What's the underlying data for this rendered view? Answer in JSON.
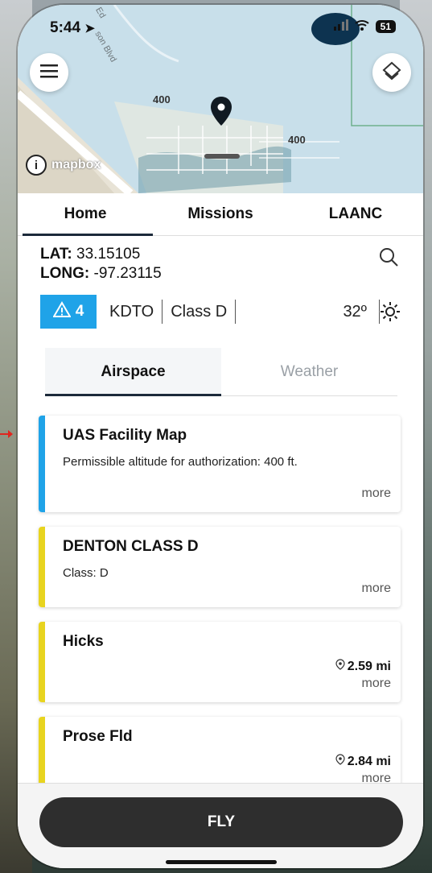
{
  "status": {
    "time": "5:44",
    "battery": "51"
  },
  "map": {
    "labels": [
      "400",
      "400",
      "Ed",
      "son Blvd"
    ],
    "attribution": "mapbox",
    "info_glyph": "i",
    "water_color": "#c8dfea"
  },
  "tabs": [
    {
      "label": "Home",
      "active": true
    },
    {
      "label": "Missions",
      "active": false
    },
    {
      "label": "LAANC",
      "active": false
    }
  ],
  "location": {
    "lat_label": "LAT:",
    "lat_value": "33.15105",
    "long_label": "LONG:",
    "long_value": "-97.23115"
  },
  "summary": {
    "warning_count": "4",
    "airport": "KDTO",
    "airspace_class": "Class D",
    "temperature": "32º"
  },
  "subtabs": [
    {
      "label": "Airspace",
      "active": true
    },
    {
      "label": "Weather",
      "active": false
    }
  ],
  "cards": [
    {
      "title": "UAS Facility Map",
      "desc": "Permissible altitude for authorization: 400 ft.",
      "distance": "",
      "more": "more",
      "color": "#1fa3e8"
    },
    {
      "title": "DENTON CLASS D",
      "desc": "Class: D",
      "distance": "",
      "more": "more",
      "color": "#e8d41f"
    },
    {
      "title": "Hicks",
      "desc": "",
      "distance": "2.59 mi",
      "more": "more",
      "color": "#e8d41f"
    },
    {
      "title": "Prose Fld",
      "desc": "",
      "distance": "2.84 mi",
      "more": "more",
      "color": "#e8d41f"
    }
  ],
  "fly_label": "FLY",
  "colors": {
    "accent": "#1fa3e8",
    "tab_underline": "#1c2a3a",
    "fly_button": "#2e2e2e"
  },
  "icons": [
    "location-arrow-icon",
    "signal-icon",
    "wifi-icon",
    "battery-icon",
    "menu-icon",
    "layers-icon",
    "map-pin-icon",
    "info-icon",
    "search-icon",
    "warning-icon",
    "sun-icon",
    "location-pin-icon"
  ]
}
